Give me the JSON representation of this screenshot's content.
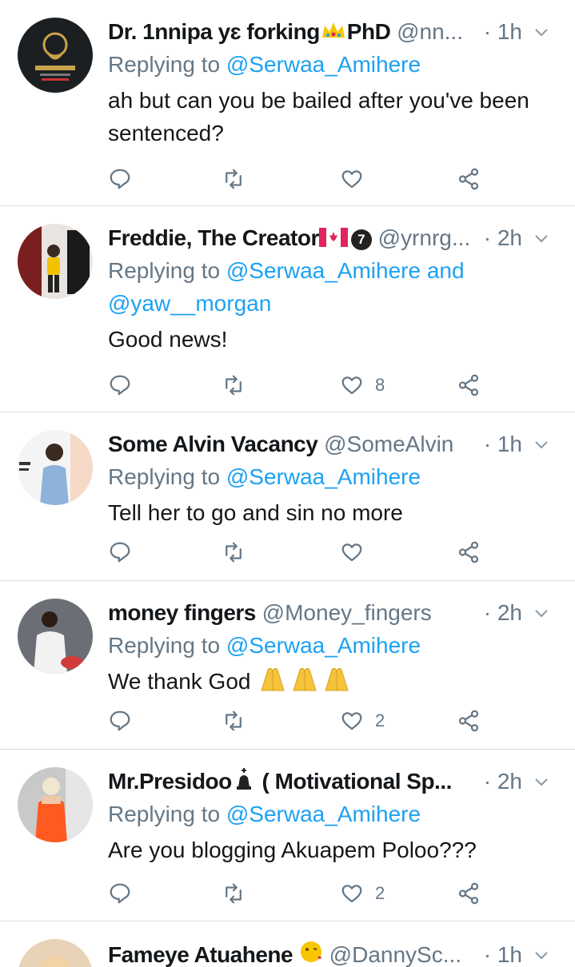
{
  "tweets": [
    {
      "name": "Dr. 1nnipa yɛ forking",
      "name_suffix": "PhD",
      "handle": "@nn...",
      "time": "· 1h",
      "replying_prefix": "Replying to",
      "mention1": "@Serwaa_Amihere",
      "text": "ah but can you be bailed after you've been sentenced?",
      "likes": ""
    },
    {
      "name": "Freddie, The Creator",
      "badge": "7",
      "handle": "@yrnrg...",
      "time": "· 2h",
      "replying_prefix": "Replying to",
      "mention1": "@Serwaa_Amihere",
      "mention_join": "and",
      "mention2": "@yaw__morgan",
      "text": "Good news!",
      "likes": "8"
    },
    {
      "name": "Some Alvin Vacancy",
      "handle": "@SomeAlvin",
      "time": "· 1h",
      "replying_prefix": "Replying to",
      "mention1": "@Serwaa_Amihere",
      "text": "Tell her to go and sin no more",
      "likes": ""
    },
    {
      "name": "money fingers",
      "handle": "@Money_fingers",
      "time": "· 2h",
      "replying_prefix": "Replying to",
      "mention1": "@Serwaa_Amihere",
      "text": "We thank God",
      "likes": "2"
    },
    {
      "name": "Mr.Presidoo",
      "name_suffix": "( Motivational Sp...",
      "handle": "",
      "time": "· 2h",
      "replying_prefix": "Replying to",
      "mention1": "@Serwaa_Amihere",
      "text": "Are you blogging Akuapem Poloo???",
      "likes": "2"
    },
    {
      "name": "Fameye Atuahene",
      "handle": "@DannySc...",
      "time": "· 1h"
    }
  ],
  "colors": {
    "accent": "#1da1f2",
    "muted": "#657786",
    "divider": "#d6dde3"
  },
  "icons": [
    "reply-icon",
    "retweet-icon",
    "like-icon",
    "share-icon",
    "chevron-down-icon"
  ]
}
